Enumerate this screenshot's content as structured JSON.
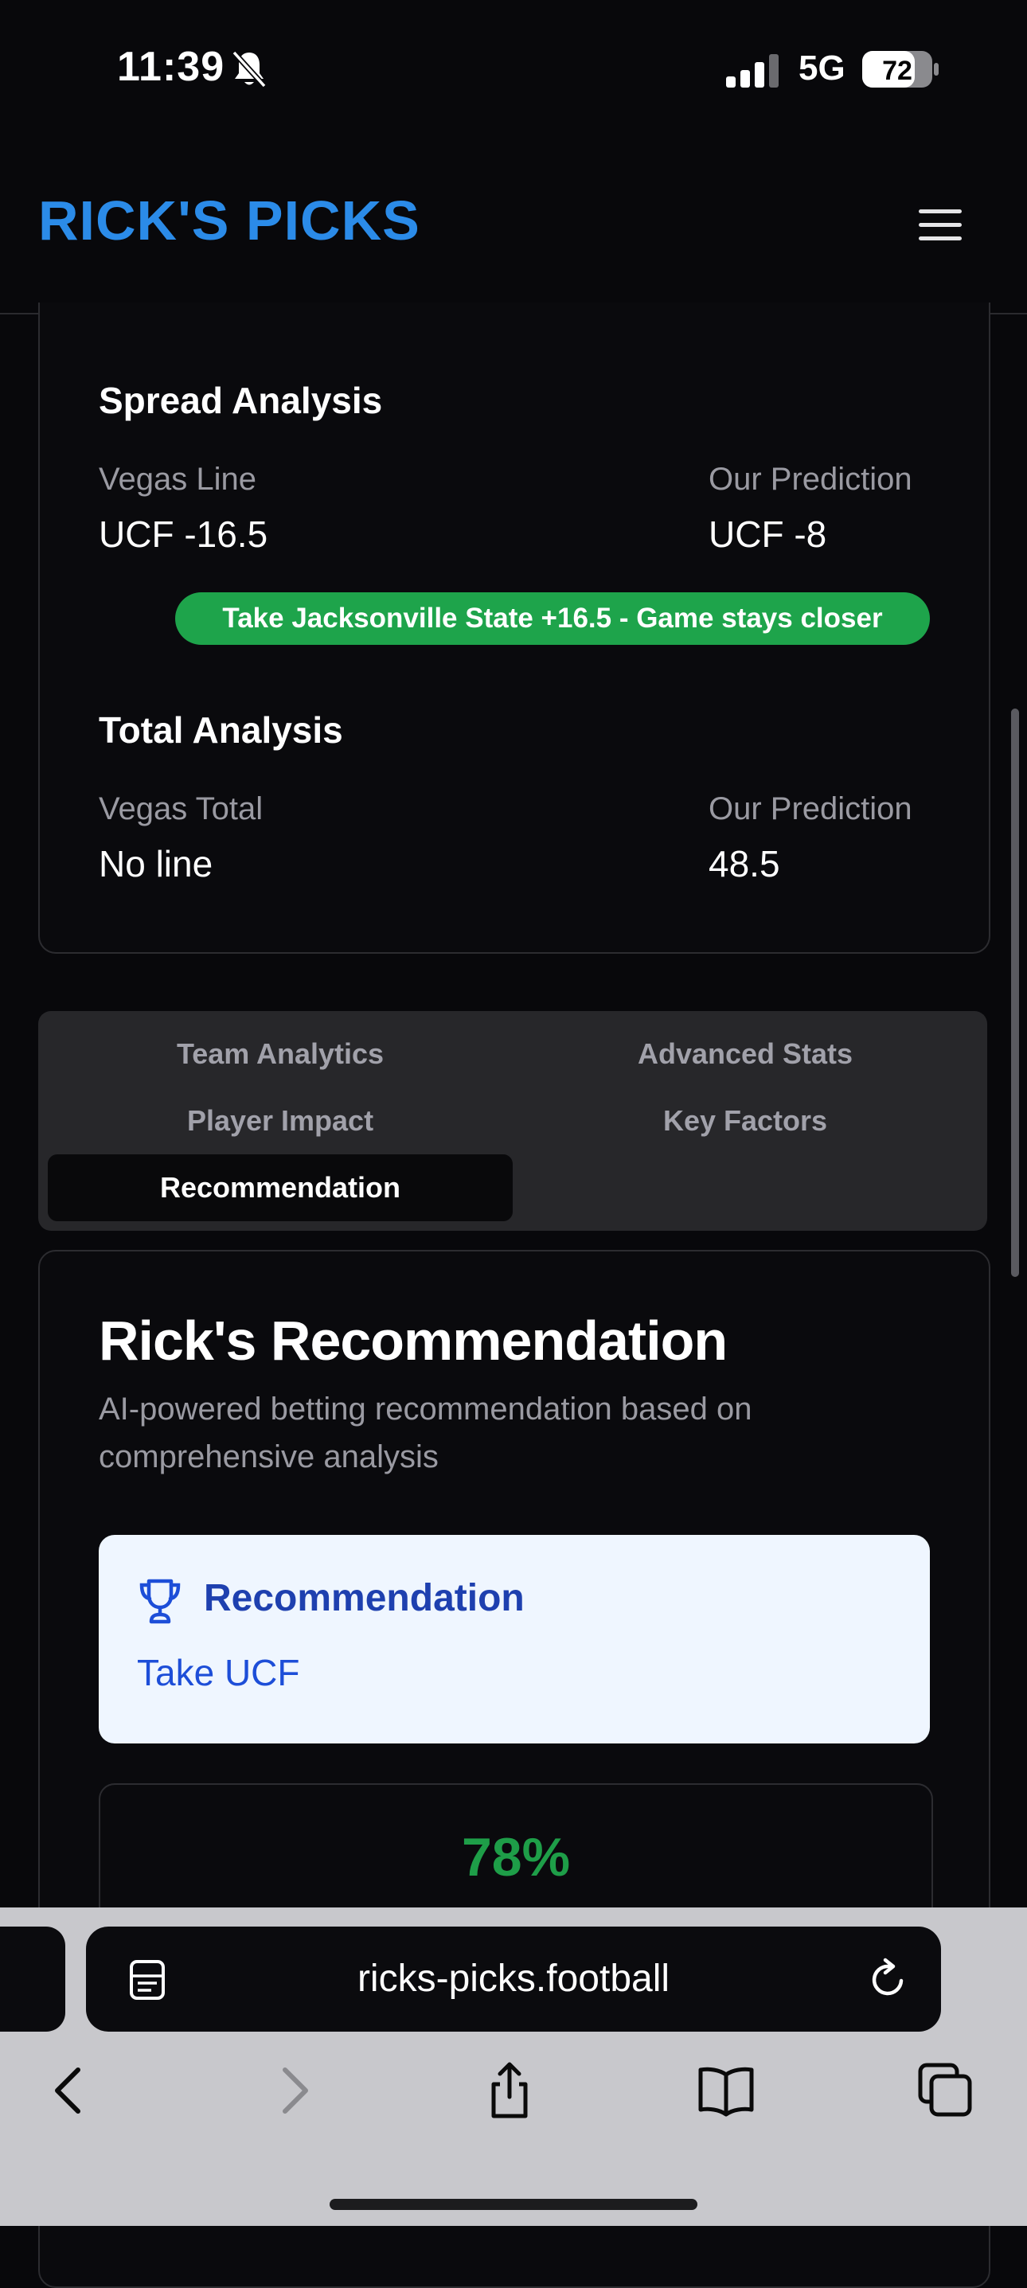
{
  "status": {
    "time": "11:39",
    "network": "5G",
    "battery": "72"
  },
  "header": {
    "brand": "RICK'S PICKS"
  },
  "spread": {
    "title": "Spread Analysis",
    "vegas_label": "Vegas Line",
    "vegas_value": "UCF -16.5",
    "pred_label": "Our Prediction",
    "pred_value": "UCF -8",
    "pill": "Take Jacksonville State +16.5 - Game stays closer"
  },
  "total": {
    "title": "Total Analysis",
    "vegas_label": "Vegas Total",
    "vegas_value": "No line",
    "pred_label": "Our Prediction",
    "pred_value": "48.5"
  },
  "tabs": [
    {
      "label": "Team Analytics"
    },
    {
      "label": "Advanced Stats"
    },
    {
      "label": "Player Impact"
    },
    {
      "label": "Key Factors"
    },
    {
      "label": "Recommendation",
      "active": true
    }
  ],
  "recommendation": {
    "title": "Rick's Recommendation",
    "subtitle": "AI-powered betting recommendation based on comprehensive analysis",
    "box_title": "Recommendation",
    "box_value": "Take UCF",
    "confidence": "78%"
  },
  "browser": {
    "url": "ricks-picks.football"
  },
  "icons": [
    "bell-slash-icon",
    "signal-icon",
    "battery-icon",
    "menu-icon",
    "trophy-icon",
    "reader-icon",
    "reload-icon",
    "back-icon",
    "forward-icon",
    "share-icon",
    "bookmarks-icon",
    "tabs-icon"
  ],
  "colors": {
    "brand": "#2b8be8",
    "pill": "#1ea44b",
    "confidence": "#1e9e48",
    "rec_bg": "#eff6ff",
    "rec_text": "#1e40af"
  }
}
